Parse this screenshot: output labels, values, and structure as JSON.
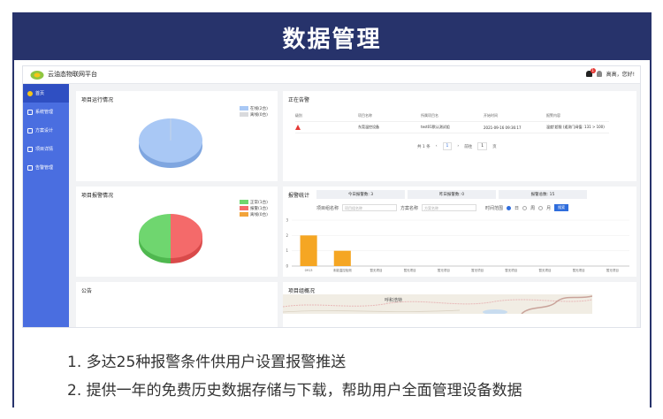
{
  "banner": {
    "title": "数据管理"
  },
  "topbar": {
    "brand": "云油态物联网平台",
    "notify_count": "1",
    "greeting": "高高，您好!"
  },
  "sidebar": {
    "items": [
      {
        "label": "首页",
        "icon": "home-icon",
        "active": true
      },
      {
        "label": "系统管理",
        "icon": "user-icon",
        "active": false
      },
      {
        "label": "方案设计",
        "icon": "design-icon",
        "active": false
      },
      {
        "label": "项目详情",
        "icon": "project-icon",
        "active": false
      },
      {
        "label": "告警管理",
        "icon": "alarm-icon",
        "active": false
      }
    ]
  },
  "project_status": {
    "title": "项目运行情况",
    "legend": [
      {
        "label": "在线(2台)",
        "color": "#a9c8f5"
      },
      {
        "label": "离线(0台)",
        "color": "#d9dadd"
      }
    ]
  },
  "alarms": {
    "title": "正在告警",
    "columns": [
      "级别",
      "项目名称",
      "所属项目名",
      "开始时间",
      "报警内容"
    ],
    "rows": [
      [
        "",
        "东莞温控设备",
        "test01默认测试组",
        "2021-09-16 09:36:17",
        "温度!超限 (遥测门阀值: 131 > 100)"
      ]
    ],
    "pager": {
      "total": "共 1 条",
      "page": "1",
      "goto_label": "前往",
      "goto_value": "1",
      "page_unit": "页"
    }
  },
  "project_alarm": {
    "title": "项目报警情况",
    "legend": [
      {
        "label": "正常(1台)",
        "color": "#6fd66f"
      },
      {
        "label": "报警(1台)",
        "color": "#f46a6a"
      },
      {
        "label": "离线(0台)",
        "color": "#f2a33a"
      }
    ]
  },
  "alarm_stats": {
    "title": "报警统计",
    "cards": [
      {
        "label": "今日报警数: 3"
      },
      {
        "label": "昨日报警数: 0"
      },
      {
        "label": "报警总数: 15"
      }
    ],
    "filters": {
      "project_label": "项目组名称",
      "project_placeholder": "项目组名称",
      "scheme_label": "方案名称",
      "scheme_placeholder": "方案名称",
      "range_label": "时间范围",
      "range_options": [
        "日",
        "周",
        "月"
      ],
      "query_label": "搜索"
    }
  },
  "chart_data": {
    "type": "bar",
    "categories": [
      "0913",
      "未能温控检测",
      "暂无项目",
      "暂无项目",
      "暂无项目",
      "暂无项目",
      "暂无项目",
      "暂无项目",
      "暂无项目",
      "暂无项目"
    ],
    "values": [
      2,
      1,
      0,
      0,
      0,
      0,
      0,
      0,
      0,
      0
    ],
    "ylim": [
      0,
      3
    ],
    "yticks": [
      "3",
      "2",
      "1",
      "0"
    ],
    "color": "#f5a623"
  },
  "notice": {
    "title": "公告"
  },
  "project_map": {
    "title": "项目组概况",
    "place_label": "呼和浩特"
  },
  "features": {
    "line1": "1. 多达25种报警条件供用户设置报警推送",
    "line2": "2. 提供一年的免费历史数据存储与下载，帮助用户全面管理设备数据"
  }
}
